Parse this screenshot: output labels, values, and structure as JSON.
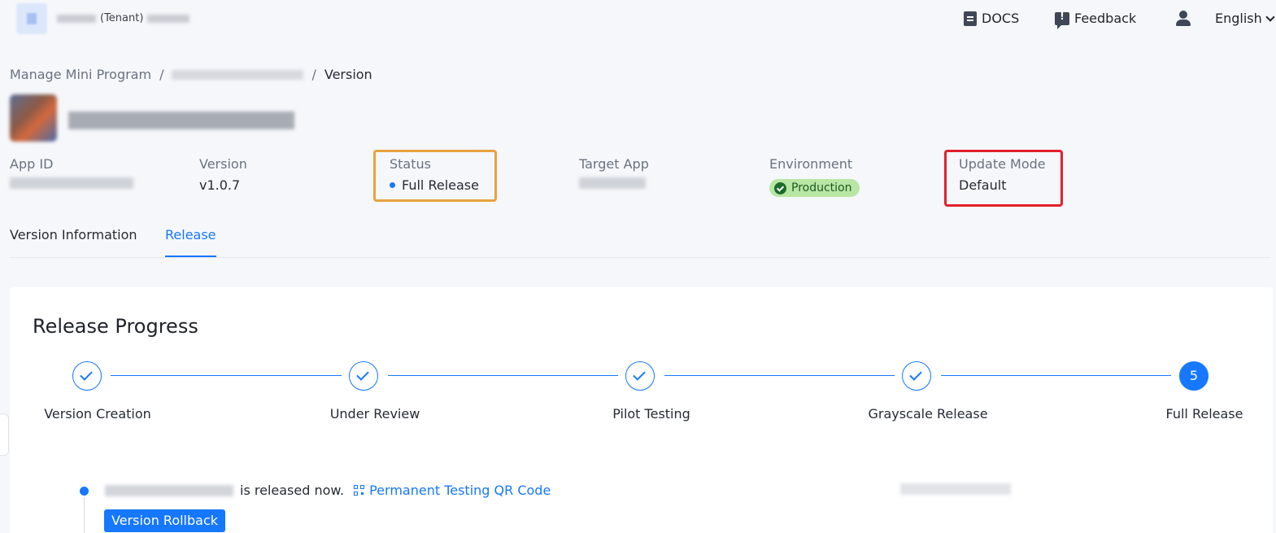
{
  "topbar": {
    "tenant_suffix": "(Tenant)",
    "docs_label": "DOCS",
    "feedback_label": "Feedback",
    "language": "English"
  },
  "breadcrumb": {
    "root": "Manage Mini Program",
    "separator": "/",
    "current": "Version"
  },
  "meta": {
    "app_id_label": "App ID",
    "version_label": "Version",
    "version_value": "v1.0.7",
    "status_label": "Status",
    "status_value": "Full Release",
    "target_app_label": "Target App",
    "environment_label": "Environment",
    "environment_value": "Production",
    "update_mode_label": "Update Mode",
    "update_mode_value": "Default"
  },
  "tabs": [
    {
      "label": "Version Information",
      "active": false
    },
    {
      "label": "Release",
      "active": true
    }
  ],
  "release_progress": {
    "title": "Release Progress",
    "steps": [
      {
        "label": "Version Creation",
        "done": true
      },
      {
        "label": "Under Review",
        "done": true
      },
      {
        "label": "Pilot Testing",
        "done": true
      },
      {
        "label": "Grayscale Release",
        "done": true
      },
      {
        "label": "Full Release",
        "done": false,
        "number": "5"
      }
    ]
  },
  "timeline": {
    "released_text": "is released now.",
    "qr_link_label": "Permanent Testing QR Code",
    "rollback_button": "Version Rollback"
  },
  "colors": {
    "primary": "#1677ff",
    "status_highlight": "#e8a23e",
    "update_mode_highlight": "#e3202a",
    "production_badge_bg": "#b9e6a4"
  }
}
